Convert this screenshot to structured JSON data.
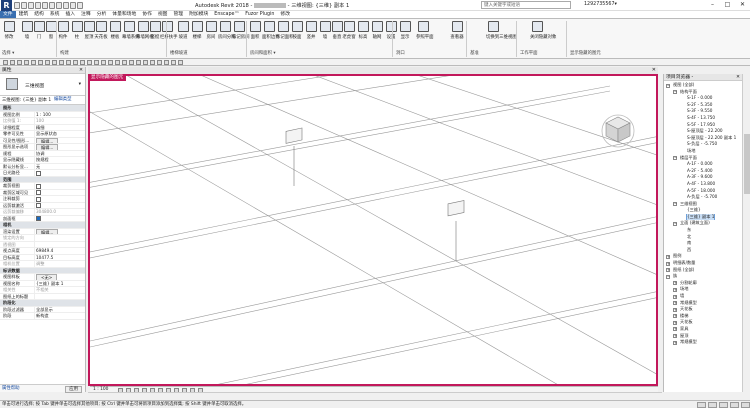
{
  "app": {
    "title": "Autodesk Revit 2018 - ",
    "title_suffix": "- 三维视图: {三维} 副本 1",
    "search_placeholder": "键入关键字或短语",
    "user": "1292735567",
    "user_suffix": "▾",
    "logo": "R"
  },
  "ribbon_tabs": [
    "文件",
    "建筑",
    "结构",
    "系统",
    "插入",
    "注释",
    "分析",
    "体量和场地",
    "协作",
    "视图",
    "管理",
    "附加模块",
    "Enscape™",
    "Fuzor Plugin",
    "修改"
  ],
  "active_tab": 0,
  "ribbon": {
    "buttons": [
      "修改",
      "墙",
      "门",
      "窗",
      "构件",
      "柱",
      "屋顶",
      "天花板",
      "楼板",
      "幕墙系统",
      "幕墙网格",
      "竖梃",
      "栏杆扶手",
      "坡道",
      "楼梯",
      "房间",
      "房间分隔",
      "标记房间",
      "面积",
      "面积边界",
      "标记面积",
      "按面",
      "竖井",
      "墙",
      "垂直",
      "老虎窗",
      "标高",
      "轴网",
      "设置",
      "显示",
      "参照平面",
      "查看器",
      "切换到三维视图",
      "关闭隐藏对象"
    ],
    "groups": [
      "选择 ▾",
      "构建",
      "楼梯坡道",
      "房间和面积 ▾",
      "洞口",
      "基准",
      "工作平面",
      "显示隐藏的图元"
    ],
    "tool_label": "关闭隐藏对象"
  },
  "properties": {
    "title": "属性",
    "type_name": "三维视图",
    "view_selector": "三维视图: {三维} 副本 1",
    "edit_type": "编辑类型",
    "rows": [
      {
        "k": "图形",
        "v": "",
        "grp": true
      },
      {
        "k": "视图比例",
        "v": "1 : 100"
      },
      {
        "k": "比例值 1:",
        "v": "100",
        "dim": true
      },
      {
        "k": "详细程度",
        "v": "精细"
      },
      {
        "k": "零件可见性",
        "v": "显示原状态"
      },
      {
        "k": "可见性/图形...",
        "v": "编辑...",
        "btn": true
      },
      {
        "k": "图形显示选项",
        "v": "编辑...",
        "btn": true
      },
      {
        "k": "规程",
        "v": "协调"
      },
      {
        "k": "显示隐藏线",
        "v": "按规程"
      },
      {
        "k": "默认分析显...",
        "v": "无"
      },
      {
        "k": "日光路径",
        "v": "",
        "cb": false
      },
      {
        "k": "范围",
        "v": "",
        "grp": true
      },
      {
        "k": "裁剪视图",
        "v": "",
        "cb": false
      },
      {
        "k": "裁剪区域可见",
        "v": "",
        "cb": false
      },
      {
        "k": "注释裁剪",
        "v": "",
        "cb": false
      },
      {
        "k": "远剪裁激活",
        "v": "",
        "cb": false
      },
      {
        "k": "远剪裁偏移",
        "v": "304800.0",
        "dim": true
      },
      {
        "k": "剖面框",
        "v": "",
        "cb": true
      },
      {
        "k": "相机",
        "v": "",
        "grp": true
      },
      {
        "k": "渲染设置",
        "v": "编辑...",
        "btn": true
      },
      {
        "k": "锁定的方向",
        "v": "",
        "dim": true
      },
      {
        "k": "透视图",
        "v": "",
        "dim": true
      },
      {
        "k": "视点高度",
        "v": "69849.4"
      },
      {
        "k": "目标高度",
        "v": "10477.5"
      },
      {
        "k": "相机位置",
        "v": "调整",
        "dim": true
      },
      {
        "k": "标识数据",
        "v": "",
        "grp": true
      },
      {
        "k": "视图样板",
        "v": "<无>",
        "btn": true
      },
      {
        "k": "视图名称",
        "v": "{三维} 副本 1"
      },
      {
        "k": "相关性",
        "v": "不相关",
        "dim": true
      },
      {
        "k": "图纸上的标题",
        "v": ""
      },
      {
        "k": "阶段化",
        "v": "",
        "grp": true
      },
      {
        "k": "阶段过滤器",
        "v": "全部显示"
      },
      {
        "k": "阶段",
        "v": "新构造"
      }
    ],
    "help_link": "属性帮助",
    "apply": "应用"
  },
  "view": {
    "banner": "显示隐藏的图元",
    "scale": "1 : 100",
    "close": "✕"
  },
  "project_browser": {
    "title": "项目浏览器 - ",
    "items": [
      {
        "t": "视图 (全部)",
        "lvl": 0,
        "tg": "−"
      },
      {
        "t": "结构平面",
        "lvl": 1,
        "tg": "−"
      },
      {
        "t": "S-1F - 0.000",
        "lvl": 2
      },
      {
        "t": "S-2F - 5.350",
        "lvl": 2
      },
      {
        "t": "S-3F - 9.550",
        "lvl": 2
      },
      {
        "t": "S-4F - 13.750",
        "lvl": 2
      },
      {
        "t": "S-5F - 17.950",
        "lvl": 2
      },
      {
        "t": "S-屋顶层 - 22.200",
        "lvl": 2
      },
      {
        "t": "S-屋顶层 - 22.200 副本 1",
        "lvl": 2
      },
      {
        "t": "S-负层 - -5.750",
        "lvl": 2
      },
      {
        "t": "场地",
        "lvl": 2
      },
      {
        "t": "楼层平面",
        "lvl": 1,
        "tg": "−"
      },
      {
        "t": "A-1F - 0.000",
        "lvl": 2
      },
      {
        "t": "A-2F - 5.400",
        "lvl": 2
      },
      {
        "t": "A-3F - 9.600",
        "lvl": 2
      },
      {
        "t": "A-4F - 13.800",
        "lvl": 2
      },
      {
        "t": "A-5F - 18.000",
        "lvl": 2
      },
      {
        "t": "A-负层 - -5.700",
        "lvl": 2
      },
      {
        "t": "三维视图",
        "lvl": 1,
        "tg": "−"
      },
      {
        "t": "{三维}",
        "lvl": 2
      },
      {
        "t": "{三维} 副本 1",
        "lvl": 2,
        "sel": true
      },
      {
        "t": "立面 (建筑立面)",
        "lvl": 1,
        "tg": "−"
      },
      {
        "t": "东",
        "lvl": 2
      },
      {
        "t": "北",
        "lvl": 2
      },
      {
        "t": "南",
        "lvl": 2
      },
      {
        "t": "西",
        "lvl": 2
      },
      {
        "t": "图例",
        "lvl": 0,
        "tg": "+"
      },
      {
        "t": "明细表/数量",
        "lvl": 0,
        "tg": "+"
      },
      {
        "t": "图纸 (全部)",
        "lvl": 0,
        "tg": "+"
      },
      {
        "t": "族",
        "lvl": 0,
        "tg": "−"
      },
      {
        "t": "分割轮廓",
        "lvl": 1,
        "tg": "+"
      },
      {
        "t": "场地",
        "lvl": 1,
        "tg": "+"
      },
      {
        "t": "墙",
        "lvl": 1,
        "tg": "+"
      },
      {
        "t": "常规模型",
        "lvl": 1,
        "tg": "+"
      },
      {
        "t": "天花板",
        "lvl": 1,
        "tg": "+"
      },
      {
        "t": "楼梯",
        "lvl": 1,
        "tg": "+"
      },
      {
        "t": "天花板",
        "lvl": 1,
        "tg": "+"
      },
      {
        "t": "家具",
        "lvl": 1,
        "tg": "+"
      },
      {
        "t": "屋顶",
        "lvl": 1,
        "tg": "+"
      },
      {
        "t": "常规模型",
        "lvl": 1,
        "tg": "+"
      }
    ]
  },
  "status": {
    "text": "单击可进行选择; 按 Tab 键并单击可选择其他项目; 按 Ctrl 键并单击可将新项目添加到选择集; 按 Shift 键并单击可取消选择。"
  }
}
